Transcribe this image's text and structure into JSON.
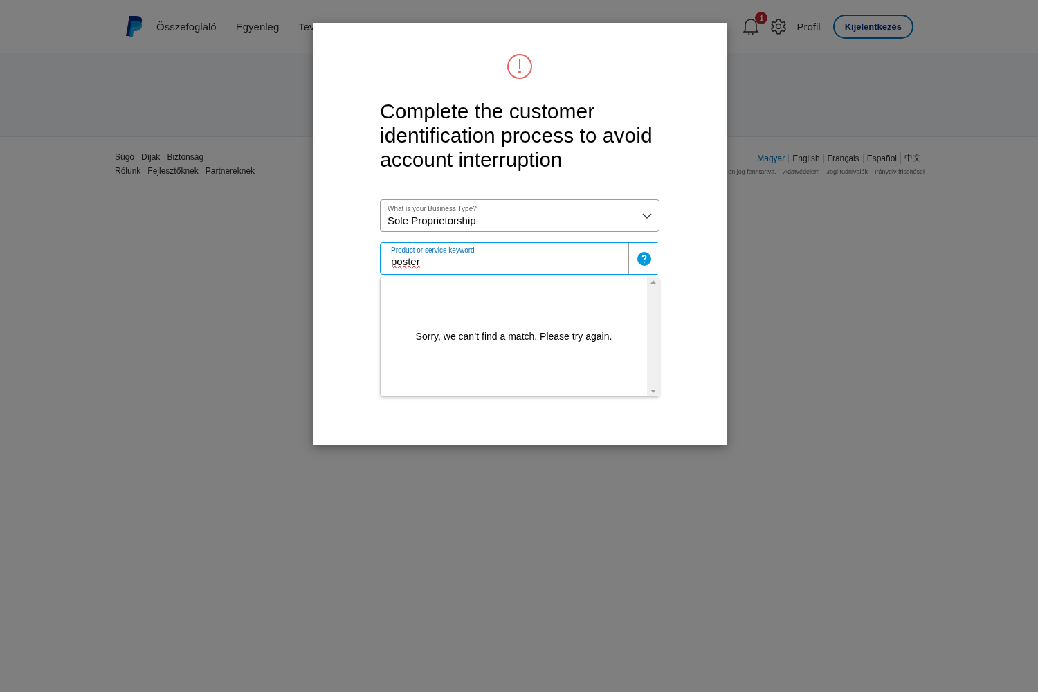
{
  "header": {
    "nav": [
      {
        "label": "Összefoglaló"
      },
      {
        "label": "Egyenleg"
      },
      {
        "label": "Tev"
      }
    ],
    "notifications": {
      "count": "1"
    },
    "profile": "Profil",
    "logout": "Kijelentkezés"
  },
  "footer": {
    "links_row_1": [
      "Súgó",
      "Díjak",
      "Biztonság"
    ],
    "links_row_2": [
      "Rólunk",
      "Fejlesztőknek",
      "Partnereknek"
    ],
    "languages": [
      {
        "label": "Magyar",
        "selected": true
      },
      {
        "label": "English",
        "selected": false
      },
      {
        "label": "Français",
        "selected": false
      },
      {
        "label": "Español",
        "selected": false
      },
      {
        "label": "中文",
        "selected": false
      }
    ],
    "legal": [
      "en jog fenntartva.",
      "Adatvédelem",
      "Jogi tudnivalók",
      "Irányelv frissítései"
    ]
  },
  "modal": {
    "title": "Complete the customer identification process to avoid account interruption",
    "business_type": {
      "label": "What is your Business Type?",
      "value": "Sole Proprietorship"
    },
    "keyword": {
      "label": "Product or service keyword",
      "value": "poster"
    },
    "results": {
      "message": "Sorry, we can’t find a match. Please try again."
    }
  }
}
